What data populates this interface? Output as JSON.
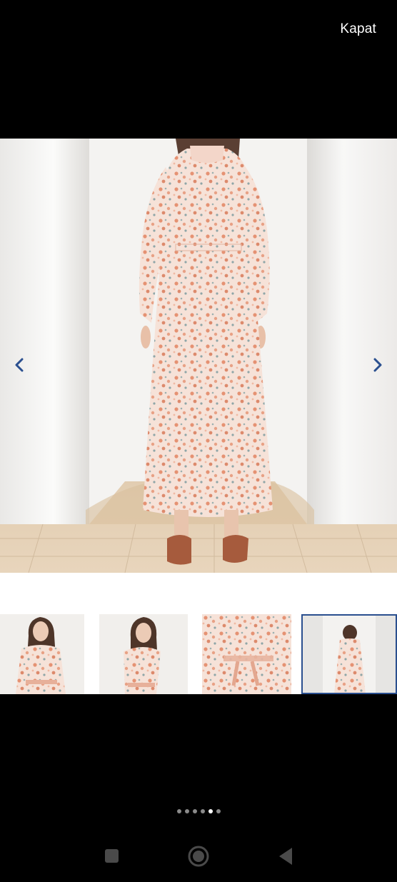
{
  "header": {
    "close_label": "Kapat"
  },
  "gallery": {
    "image_count": 6,
    "active_index": 4,
    "main_image": "product-photo-back-view",
    "thumbnails": [
      {
        "id": "thumb-front-1",
        "selected": false
      },
      {
        "id": "thumb-front-2",
        "selected": false
      },
      {
        "id": "thumb-detail",
        "selected": false
      },
      {
        "id": "thumb-back",
        "selected": true
      }
    ],
    "controls": {
      "prev_icon": "chevron-left-icon",
      "next_icon": "chevron-right-icon"
    }
  },
  "system_nav": {
    "recents_icon": "square-icon",
    "home_icon": "circle-icon",
    "back_icon": "triangle-back-icon"
  },
  "colors": {
    "background": "#000000",
    "arrow": "#2a4f8f",
    "selected_border": "#2a4f8f",
    "dress_base": "#f6ddd2",
    "dress_flower": "#e49274"
  }
}
